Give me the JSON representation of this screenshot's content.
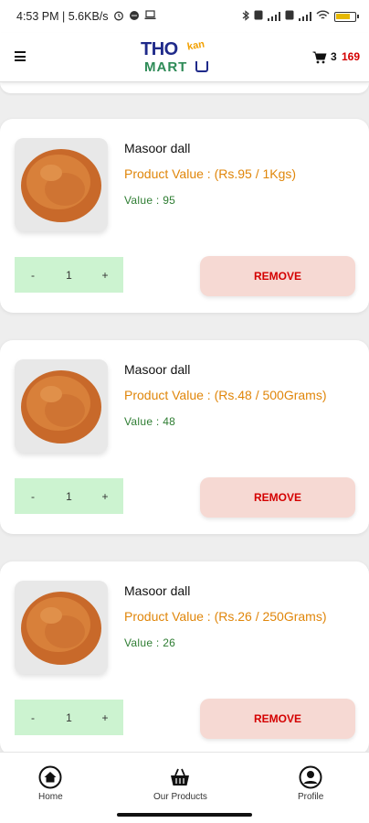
{
  "status_bar": {
    "time_and_speed": "4:53 PM | 5.6KB/s",
    "battery": "69"
  },
  "header": {
    "logo": {
      "text_top": "THO",
      "text_tag": "kan",
      "text_bottom": "MART"
    },
    "cart_count": "3",
    "cart_total": "169"
  },
  "cart_items": [
    {
      "name": "Masoor dall",
      "product_value": "Product Value : (Rs.95 / 1Kgs)",
      "value": "Value :  95",
      "quantity": "1",
      "minus_label": "-",
      "plus_label": "+",
      "remove_label": "REMOVE"
    },
    {
      "name": "Masoor dall",
      "product_value": "Product Value : (Rs.48 / 500Grams)",
      "value": "Value :  48",
      "quantity": "1",
      "minus_label": "-",
      "plus_label": "+",
      "remove_label": "REMOVE"
    },
    {
      "name": "Masoor dall",
      "product_value": "Product Value : (Rs.26 / 250Grams)",
      "value": "Value :  26",
      "quantity": "1",
      "minus_label": "-",
      "plus_label": "+",
      "remove_label": "REMOVE"
    }
  ],
  "bottom_nav": {
    "items": [
      {
        "label": "Home",
        "icon": "home-icon"
      },
      {
        "label": "Our Products",
        "icon": "basket-icon"
      },
      {
        "label": "Profile",
        "icon": "profile-icon"
      }
    ]
  },
  "colors": {
    "price_orange": "#e0860a",
    "value_green": "#2e7d32",
    "stepper_bg": "#ccf3d0",
    "remove_bg": "#f6d9d3",
    "remove_text": "#d40000",
    "cart_total_red": "#d40000"
  }
}
